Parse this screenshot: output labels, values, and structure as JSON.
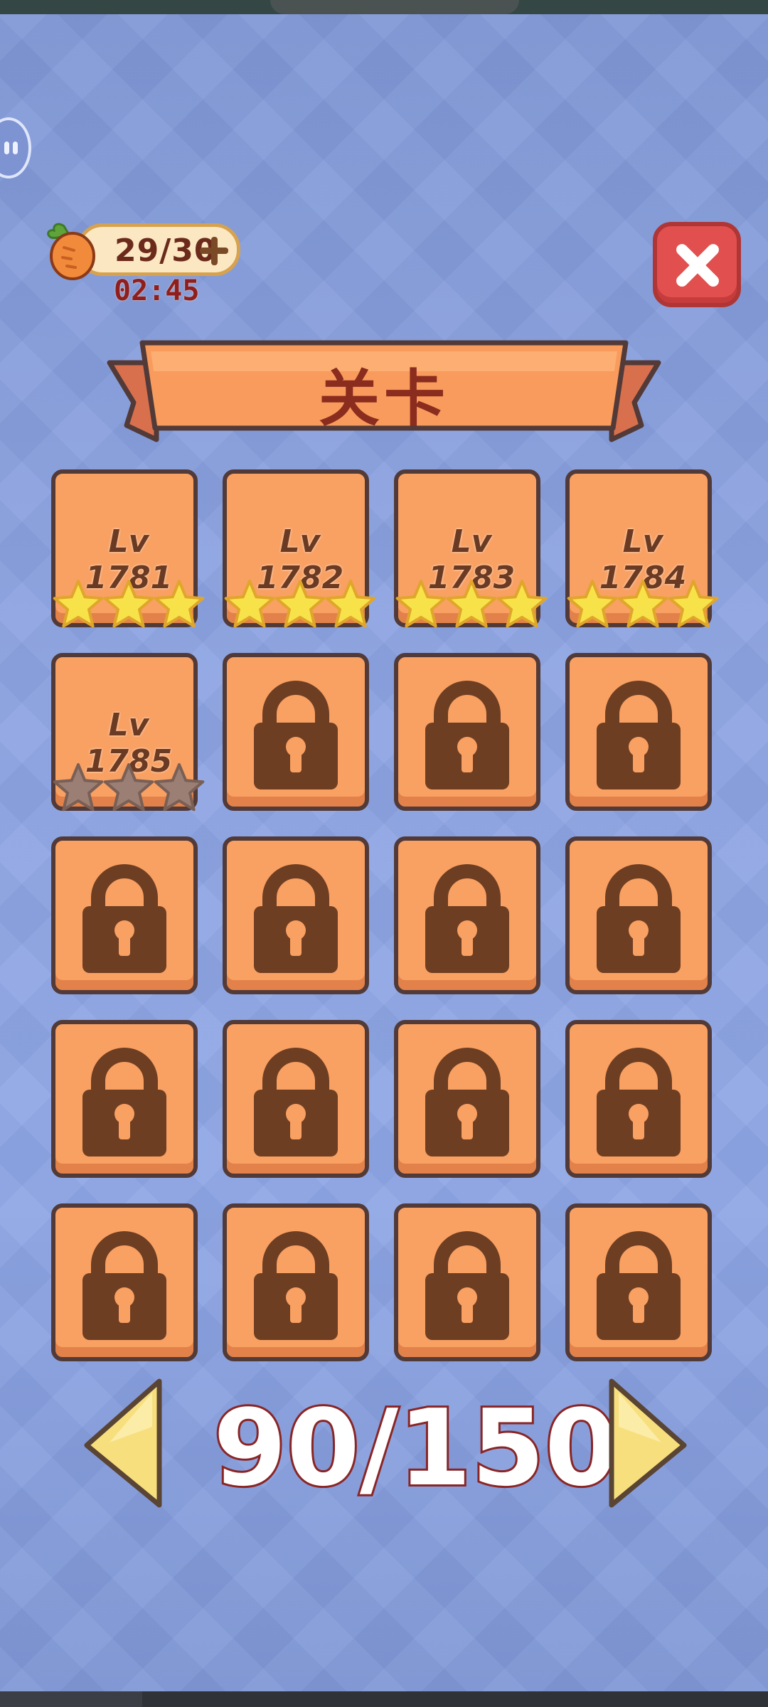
{
  "energy": {
    "value": "29/30",
    "timer": "02:45",
    "icon": "carrot-icon"
  },
  "title": "关卡",
  "colors": {
    "tile": "#f9a063",
    "border": "#523a38",
    "star_on": "#f8e24a",
    "star_off": "#9c7f74",
    "close": "#e24f4f"
  },
  "levels": [
    {
      "label": "Lv  1781",
      "stars": 3,
      "locked": false
    },
    {
      "label": "Lv  1782",
      "stars": 3,
      "locked": false
    },
    {
      "label": "Lv  1783",
      "stars": 3,
      "locked": false
    },
    {
      "label": "Lv  1784",
      "stars": 3,
      "locked": false
    },
    {
      "label": "Lv  1785",
      "stars": 0,
      "locked": false
    },
    {
      "locked": true
    },
    {
      "locked": true
    },
    {
      "locked": true
    },
    {
      "locked": true
    },
    {
      "locked": true
    },
    {
      "locked": true
    },
    {
      "locked": true
    },
    {
      "locked": true
    },
    {
      "locked": true
    },
    {
      "locked": true
    },
    {
      "locked": true
    },
    {
      "locked": true
    },
    {
      "locked": true
    },
    {
      "locked": true
    },
    {
      "locked": true
    }
  ],
  "pager": {
    "text": "90/150"
  }
}
